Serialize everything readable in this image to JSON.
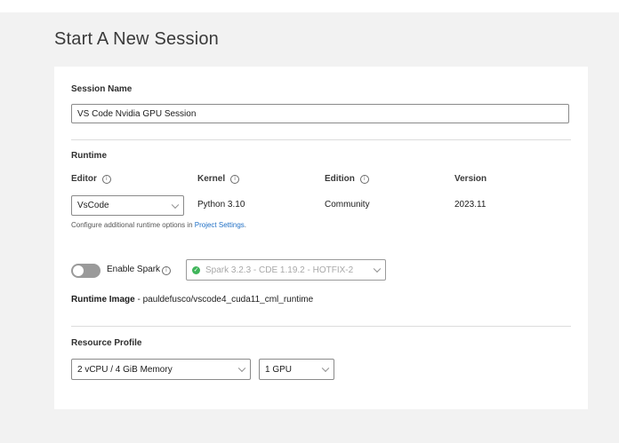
{
  "page": {
    "title": "Start A New Session"
  },
  "session_name": {
    "label": "Session Name",
    "value": "VS Code Nvidia GPU Session"
  },
  "runtime": {
    "heading": "Runtime",
    "columns": {
      "editor": "Editor",
      "kernel": "Kernel",
      "edition": "Edition",
      "version": "Version"
    },
    "editor_value": "VsCode",
    "kernel_value": "Python 3.10",
    "edition_value": "Community",
    "version_value": "2023.11",
    "hint_text": "Configure additional runtime options in ",
    "hint_link": "Project Settings",
    "hint_end": "."
  },
  "spark": {
    "toggle_label": "Enable Spark",
    "enabled": false,
    "version_value": "Spark 3.2.3 - CDE 1.19.2 - HOTFIX-2"
  },
  "runtime_image": {
    "label": "Runtime Image",
    "separator": " - ",
    "value": "pauldefusco/vscode4_cuda11_cml_runtime"
  },
  "resource_profile": {
    "label": "Resource Profile",
    "cpu_memory": "2 vCPU / 4 GiB Memory",
    "gpu": "1 GPU"
  },
  "icons": {
    "info": "info-icon",
    "chevron": "chevron-down-icon",
    "check": "check-circle-icon"
  },
  "colors": {
    "link": "#1f6fc5",
    "check": "#3fb55a",
    "toggle_off": "#9a9a9a"
  }
}
